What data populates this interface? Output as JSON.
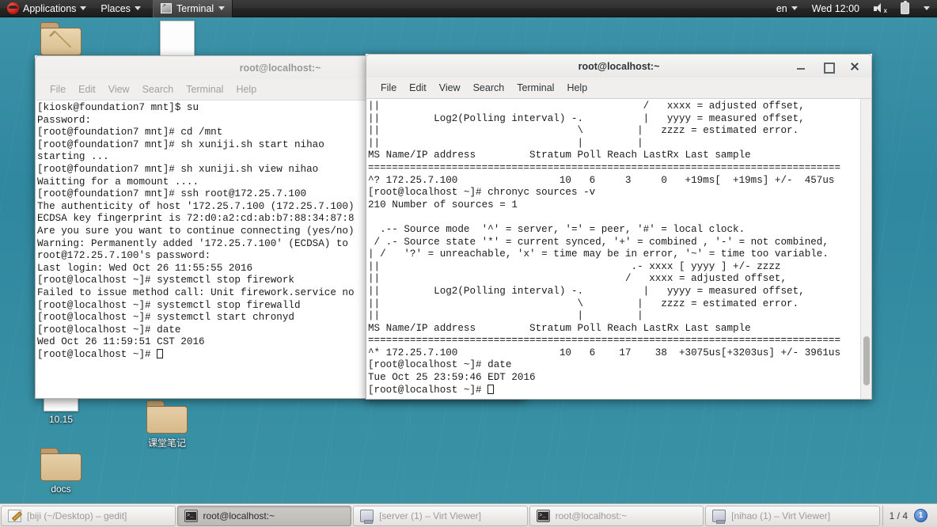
{
  "top_panel": {
    "applications_label": "Applications",
    "places_label": "Places",
    "terminal_indicator_label": "Terminal",
    "language_label": "en",
    "clock_label": "Wed 12:00"
  },
  "desktop_icons": [
    {
      "name": "10.15",
      "type": "document"
    },
    {
      "name": "课堂笔记",
      "type": "folder"
    },
    {
      "name": "docs",
      "type": "folder"
    }
  ],
  "left_window": {
    "title": "root@localhost:~",
    "active": false,
    "menus": [
      "File",
      "Edit",
      "View",
      "Search",
      "Terminal",
      "Help"
    ],
    "lines": [
      "[kiosk@foundation7 mnt]$ su",
      "Password:",
      "[root@foundation7 mnt]# cd /mnt",
      "[root@foundation7 mnt]# sh xuniji.sh start nihao",
      "starting ...",
      "[root@foundation7 mnt]# sh xuniji.sh view nihao",
      "Waitting for a momount ....",
      "[root@foundation7 mnt]# ssh root@172.25.7.100",
      "The authenticity of host '172.25.7.100 (172.25.7.100)",
      "ECDSA key fingerprint is 72:d0:a2:cd:ab:b7:88:34:87:8",
      "Are you sure you want to continue connecting (yes/no)",
      "Warning: Permanently added '172.25.7.100' (ECDSA) to ",
      "root@172.25.7.100's password:",
      "Last login: Wed Oct 26 11:55:55 2016",
      "[root@localhost ~]# systemctl stop firework",
      "Failed to issue method call: Unit firework.service no",
      "[root@localhost ~]# systemctl stop firewalld",
      "[root@localhost ~]# systemctl start chronyd",
      "[root@localhost ~]# date",
      "Wed Oct 26 11:59:51 CST 2016"
    ],
    "prompt": "[root@localhost ~]# "
  },
  "right_window": {
    "title": "root@localhost:~",
    "active": true,
    "menus": [
      "File",
      "Edit",
      "View",
      "Search",
      "Terminal",
      "Help"
    ],
    "buttons": {
      "minimize": "minimize",
      "maximize": "maximize",
      "close": "close"
    },
    "lines": [
      "||                                            /   xxxx = adjusted offset,",
      "||         Log2(Polling interval) -.          |   yyyy = measured offset,",
      "||                                 \\         |   zzzz = estimated error.",
      "||                                 |         |",
      "MS Name/IP address         Stratum Poll Reach LastRx Last sample",
      "===============================================================================",
      "^? 172.25.7.100                 10   6     3     0   +19ms[  +19ms] +/-  457us",
      "[root@localhost ~]# chronyc sources -v",
      "210 Number of sources = 1",
      "",
      "  .-- Source mode  '^' = server, '=' = peer, '#' = local clock.",
      " / .- Source state '*' = current synced, '+' = combined , '-' = not combined,",
      "| /   '?' = unreachable, 'x' = time may be in error, '~' = time too variable.",
      "||                                          .- xxxx [ yyyy ] +/- zzzz",
      "||                                         /   xxxx = adjusted offset,",
      "||         Log2(Polling interval) -.          |   yyyy = measured offset,",
      "||                                 \\         |   zzzz = estimated error.",
      "||                                 |         |",
      "MS Name/IP address         Stratum Poll Reach LastRx Last sample",
      "===============================================================================",
      "^* 172.25.7.100                 10   6    17    38  +3075us[+3203us] +/- 3961us",
      "[root@localhost ~]# date",
      "Tue Oct 25 23:59:46 EDT 2016"
    ],
    "prompt": "[root@localhost ~]# "
  },
  "taskbar": {
    "items": [
      {
        "label": "[biji (~/Desktop) – gedit]",
        "icon": "gedit-icon",
        "focused": false
      },
      {
        "label": "root@localhost:~",
        "icon": "terminal-icon",
        "focused": true
      },
      {
        "label": "[server (1) – Virt Viewer]",
        "icon": "virt-viewer-icon",
        "focused": false
      },
      {
        "label": "root@localhost:~",
        "icon": "terminal-icon",
        "focused": false
      },
      {
        "label": "[nihao (1) – Virt Viewer]",
        "icon": "virt-viewer-icon",
        "focused": false
      }
    ],
    "workspace_label": "1 / 4",
    "workspace_number": "1"
  }
}
